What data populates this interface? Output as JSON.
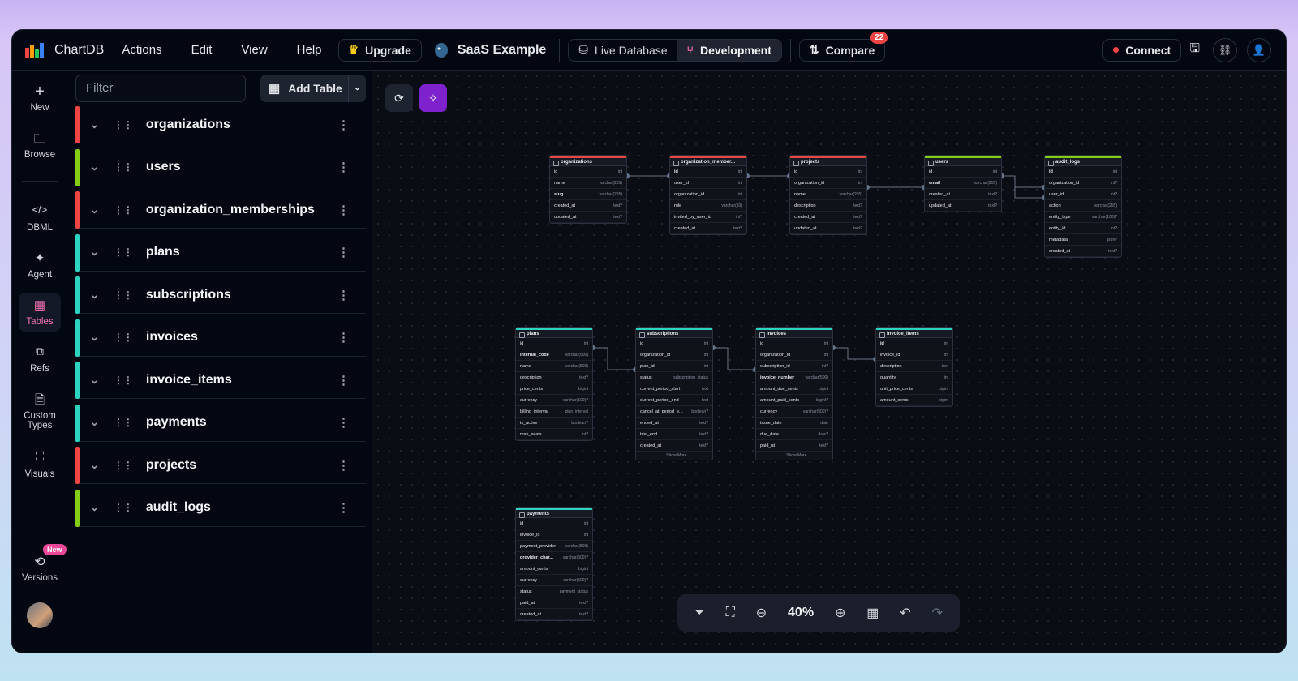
{
  "app": {
    "name": "ChartDB"
  },
  "menu": [
    "Actions",
    "Edit",
    "View",
    "Help"
  ],
  "upgrade": "Upgrade",
  "diagram_name": "SaaS Example",
  "env": {
    "live": "Live Database",
    "dev": "Development"
  },
  "compare": {
    "label": "Compare",
    "badge": "22"
  },
  "connect": "Connect",
  "rail": {
    "new": "New",
    "browse": "Browse",
    "dbml": "DBML",
    "agent": "Agent",
    "tables": "Tables",
    "refs": "Refs",
    "custom_types_1": "Custom",
    "custom_types_2": "Types",
    "visuals": "Visuals",
    "versions": "Versions",
    "versions_badge": "New"
  },
  "sidebar": {
    "filter_placeholder": "Filter",
    "add_table": "Add Table",
    "tables": [
      {
        "name": "organizations",
        "color": "#ef4444"
      },
      {
        "name": "users",
        "color": "#84cc16"
      },
      {
        "name": "organization_memberships",
        "color": "#ef4444"
      },
      {
        "name": "plans",
        "color": "#2dd4bf"
      },
      {
        "name": "subscriptions",
        "color": "#2dd4bf"
      },
      {
        "name": "invoices",
        "color": "#2dd4bf"
      },
      {
        "name": "invoice_items",
        "color": "#2dd4bf"
      },
      {
        "name": "payments",
        "color": "#2dd4bf"
      },
      {
        "name": "projects",
        "color": "#ef4444"
      },
      {
        "name": "audit_logs",
        "color": "#84cc16"
      }
    ]
  },
  "zoom": "40%",
  "diagram_tables": [
    {
      "name": "organizations",
      "color": "#ef4444",
      "rows": [
        [
          "id",
          "int"
        ],
        [
          "name",
          "varchar(255)"
        ],
        [
          "slug",
          "varchar(255)"
        ],
        [
          "created_at",
          "text?"
        ],
        [
          "updated_at",
          "text?"
        ]
      ],
      "bold": [
        2
      ]
    },
    {
      "name": "organization_member...",
      "color": "#ef4444",
      "rows": [
        [
          "id",
          "int"
        ],
        [
          "user_id",
          "int"
        ],
        [
          "organization_id",
          "int"
        ],
        [
          "role",
          "varchar(50)"
        ],
        [
          "invited_by_user_id",
          "int?"
        ],
        [
          "created_at",
          "text?"
        ]
      ],
      "bold": [
        0
      ]
    },
    {
      "name": "projects",
      "color": "#ef4444",
      "rows": [
        [
          "id",
          "int"
        ],
        [
          "organization_id",
          "int"
        ],
        [
          "name",
          "varchar(255)"
        ],
        [
          "description",
          "text?"
        ],
        [
          "created_at",
          "text?"
        ],
        [
          "updated_at",
          "text?"
        ]
      ],
      "bold": []
    },
    {
      "name": "users",
      "color": "#84cc16",
      "rows": [
        [
          "id",
          "int"
        ],
        [
          "email",
          "varchar(255)"
        ],
        [
          "created_at",
          "text?"
        ],
        [
          "updated_at",
          "text?"
        ]
      ],
      "bold": [
        1
      ]
    },
    {
      "name": "audit_logs",
      "color": "#84cc16",
      "rows": [
        [
          "id",
          "int"
        ],
        [
          "organization_id",
          "int?"
        ],
        [
          "user_id",
          "int?"
        ],
        [
          "action",
          "varchar(255)"
        ],
        [
          "entity_type",
          "varchar(100)?"
        ],
        [
          "entity_id",
          "int?"
        ],
        [
          "metadata",
          "json?"
        ],
        [
          "created_at",
          "text?"
        ]
      ],
      "bold": [
        0
      ]
    },
    {
      "name": "plans",
      "color": "#2dd4bf",
      "rows": [
        [
          "id",
          "int"
        ],
        [
          "internal_code",
          "varchar(500)"
        ],
        [
          "name",
          "varchar(500)"
        ],
        [
          "description",
          "text?"
        ],
        [
          "price_cents",
          "bigint"
        ],
        [
          "currency",
          "varchar(500)?"
        ],
        [
          "billing_interval",
          "plan_interval"
        ],
        [
          "is_active",
          "boolean?"
        ],
        [
          "max_seats",
          "int?"
        ]
      ],
      "bold": [
        1
      ]
    },
    {
      "name": "subscriptions",
      "color": "#2dd4bf",
      "rows": [
        [
          "id",
          "int"
        ],
        [
          "organization_id",
          "int"
        ],
        [
          "plan_id",
          "int"
        ],
        [
          "status",
          "subscription_status"
        ],
        [
          "current_period_start",
          "text"
        ],
        [
          "current_period_end",
          "text"
        ],
        [
          "cancel_at_period_e...",
          "boolean?"
        ],
        [
          "ended_at",
          "text?"
        ],
        [
          "trial_end",
          "text?"
        ],
        [
          "created_at",
          "text?"
        ]
      ],
      "bold": [],
      "more": "Show More"
    },
    {
      "name": "invoices",
      "color": "#2dd4bf",
      "rows": [
        [
          "id",
          "int"
        ],
        [
          "organization_id",
          "int"
        ],
        [
          "subscription_id",
          "int?"
        ],
        [
          "invoice_number",
          "varchar(500)"
        ],
        [
          "amount_due_cents",
          "bigint"
        ],
        [
          "amount_paid_cents",
          "bigint?"
        ],
        [
          "currency",
          "varchar(500)?"
        ],
        [
          "issue_date",
          "date"
        ],
        [
          "due_date",
          "date?"
        ],
        [
          "paid_at",
          "text?"
        ]
      ],
      "bold": [
        3
      ],
      "more": "Show More"
    },
    {
      "name": "invoice_items",
      "color": "#2dd4bf",
      "rows": [
        [
          "id",
          "int"
        ],
        [
          "invoice_id",
          "int"
        ],
        [
          "description",
          "text"
        ],
        [
          "quantity",
          "int"
        ],
        [
          "unit_price_cents",
          "bigint"
        ],
        [
          "amount_cents",
          "bigint"
        ]
      ],
      "bold": [
        0
      ]
    },
    {
      "name": "payments",
      "color": "#2dd4bf",
      "rows": [
        [
          "id",
          "int"
        ],
        [
          "invoice_id",
          "int"
        ],
        [
          "payment_provider",
          "varchar(500)"
        ],
        [
          "provider_char...",
          "varchar(500)?"
        ],
        [
          "amount_cents",
          "bigint"
        ],
        [
          "currency",
          "varchar(500)?"
        ],
        [
          "status",
          "payment_status"
        ],
        [
          "paid_at",
          "text?"
        ],
        [
          "created_at",
          "text?"
        ]
      ],
      "bold": [
        3
      ]
    }
  ]
}
